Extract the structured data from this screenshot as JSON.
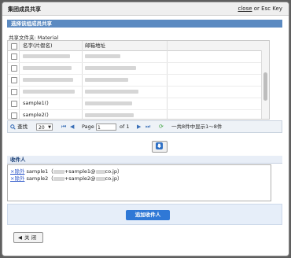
{
  "dialog": {
    "title": "集团成员共享",
    "close_link": "close",
    "close_suffix": "or Esc Key"
  },
  "panel": {
    "header": "选择该组成员共享",
    "shared_folder_label": "共享文件夹:",
    "shared_folder_value": "Material"
  },
  "grid": {
    "columns": [
      "名字(片假名)",
      "邮箱地址"
    ],
    "rows": [
      {
        "name": "",
        "email": ""
      },
      {
        "name": "",
        "email": ""
      },
      {
        "name": "",
        "email": ""
      },
      {
        "name": "",
        "email": ""
      },
      {
        "name": "sample1()",
        "email": ""
      },
      {
        "name": "sample2()",
        "email": ""
      }
    ]
  },
  "pager": {
    "search_label": "查找",
    "page_size": "20",
    "page_label": "Page",
    "page_value": "1",
    "of_label": "of 1",
    "summary": "一共8件中显示1～8件"
  },
  "receivers": {
    "header": "收件人",
    "remove_label": "×除外",
    "items": [
      {
        "prefix": "sample1（",
        "email_mid": "+sample1@",
        "email_end": "co.jp）"
      },
      {
        "prefix": "sample2（",
        "email_mid": "+sample2@",
        "email_end": "co.jp）"
      }
    ]
  },
  "add_receiver_button": "追加收件人",
  "close_button": "关 闭",
  "icons": {
    "search": "search-icon",
    "first": "first-page-icon",
    "prev": "prev-page-icon",
    "next": "next-page-icon",
    "last": "last-page-icon",
    "refresh": "refresh-icon",
    "down": "arrow-down-icon",
    "back": "arrow-left-icon"
  },
  "colors": {
    "panel_header": "#5b8ac1",
    "accent_button": "#2f78d6",
    "link": "#2b55c9"
  }
}
